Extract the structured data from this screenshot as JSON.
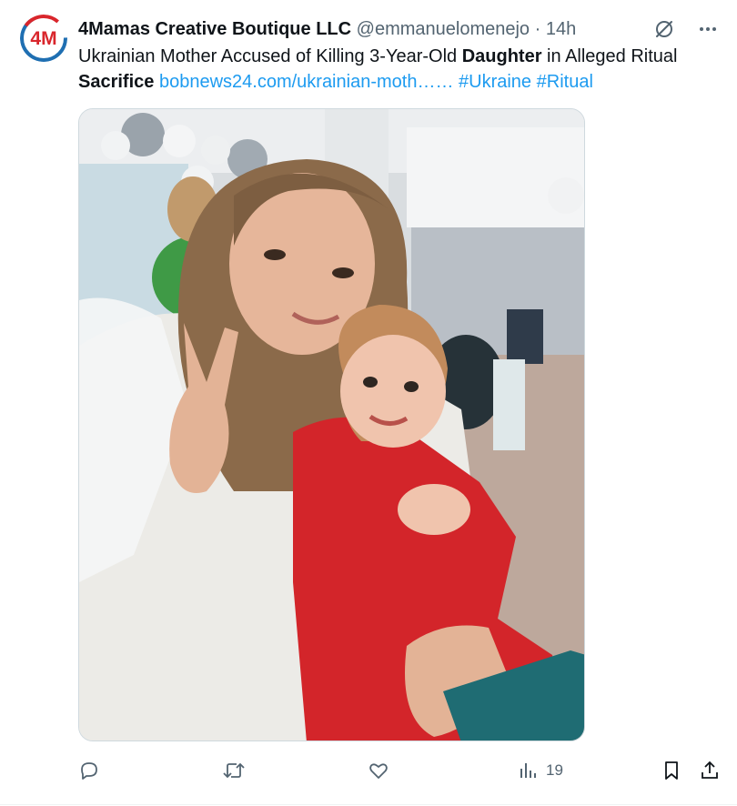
{
  "author": {
    "name": "4Mamas Creative Boutique LLC",
    "handle": "@emmanuelomenejo",
    "separator": "·",
    "time": "14h",
    "avatar_text": "4M"
  },
  "tweet": {
    "text_before": "Ukrainian Mother Accused of Killing 3-Year-Old ",
    "bold1": "Daughter",
    "text_middle": " in Alleged Ritual ",
    "bold2": "Sacrifice",
    "link": "bobnews24.com/ukrainian-moth……",
    "hashtag1": "#Ukraine",
    "hashtag2": "#Ritual"
  },
  "actions": {
    "reply_count": "",
    "retweet_count": "",
    "like_count": "",
    "views_count": "19"
  },
  "icons": {
    "grok": "slashed-circle-icon",
    "more": "more-icon",
    "reply": "reply-icon",
    "retweet": "retweet-icon",
    "like": "heart-icon",
    "views": "views-icon",
    "bookmark": "bookmark-icon",
    "share": "share-icon"
  },
  "colors": {
    "link": "#1d9bf0",
    "muted": "#536471",
    "text": "#0f1419",
    "avatar_red": "#d9262c",
    "avatar_blue": "#1f6fb2"
  }
}
